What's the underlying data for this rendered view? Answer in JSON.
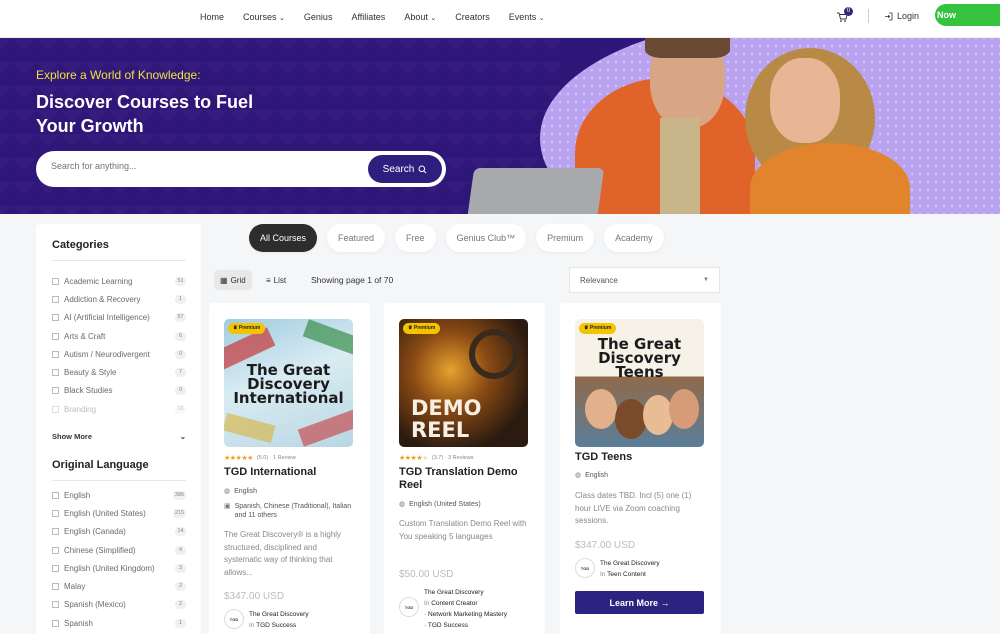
{
  "nav": {
    "links": [
      "Home",
      "Courses",
      "Genius",
      "Affiliates",
      "About",
      "Creators",
      "Events"
    ],
    "cart_count": "0",
    "login": "Login",
    "cta": "Now"
  },
  "hero": {
    "tagline": "Explore a World of Knowledge:",
    "title": "Discover Courses to Fuel Your Growth",
    "search_placeholder": "Search for anything...",
    "search_button": "Search"
  },
  "sidebar": {
    "categories_title": "Categories",
    "categories": [
      {
        "label": "Academic Learning",
        "count": "51"
      },
      {
        "label": "Addiction & Recovery",
        "count": "1"
      },
      {
        "label": "AI (Artificial Intelligence)",
        "count": "57"
      },
      {
        "label": "Arts & Craft",
        "count": "6"
      },
      {
        "label": "Autism / Neurodivergent",
        "count": "0"
      },
      {
        "label": "Beauty & Style",
        "count": "7"
      },
      {
        "label": "Black Studies",
        "count": "0"
      },
      {
        "label": "Branding",
        "count": "16"
      }
    ],
    "show_more": "Show More",
    "language_title": "Original Language",
    "languages": [
      {
        "label": "English",
        "count": "386"
      },
      {
        "label": "English (United States)",
        "count": "215"
      },
      {
        "label": "English (Canada)",
        "count": "14"
      },
      {
        "label": "Chinese (Simplified)",
        "count": "4"
      },
      {
        "label": "English (United Kingdom)",
        "count": "3"
      },
      {
        "label": "Malay",
        "count": "2"
      },
      {
        "label": "Spanish (Mexico)",
        "count": "2"
      },
      {
        "label": "Spanish",
        "count": "1"
      }
    ]
  },
  "tabs": [
    "All Courses",
    "Featured",
    "Free",
    "Genius Club™",
    "Premium",
    "Academy"
  ],
  "toolbar": {
    "grid": "Grid",
    "list": "List",
    "showing": "Showing page 1 of 70",
    "sort": "Relevance"
  },
  "cards": [
    {
      "badge": "Premium",
      "rating": "(5.0) · 1 Review",
      "title": "TGD International",
      "language": "English",
      "subtitles": "Spanish, Chinese (Traditional), Italian and 11 others",
      "description": "The Great Discovery® is a highly structured, disciplined and systematic way of thinking that allows...",
      "price": "$347.00 USD",
      "author": "The Great Discovery",
      "in": "In",
      "category": "TGD Success",
      "logo_text": "The Great Discovery International"
    },
    {
      "badge": "Premium",
      "rating": "(3.7) · 3 Reviews",
      "title": "TGD Translation Demo Reel",
      "language": "English (United States)",
      "description": "Custom Translation Demo Reel with You speaking 5 languages",
      "price": "$50.00 USD",
      "author": "The Great Discovery",
      "in": "In",
      "category": "Content Creator",
      "category2": "· Network Marketing Mastery",
      "category3": "· TGD Success",
      "logo_text": "DEMO REEL"
    },
    {
      "badge": "Premium",
      "title": "TGD Teens",
      "language": "English",
      "description": "Class dates TBD. Incl (5) one (1) hour LIVE via Zoom coaching sessions.",
      "price": "$347.00 USD",
      "author": "The Great Discovery",
      "in": "In",
      "category": "Teen Content",
      "button": "Learn More →",
      "logo_text": "The Great Discovery Teens"
    }
  ],
  "colors": {
    "hero_bg": "#2f1679",
    "accent_yellow": "#f4e23b",
    "primary": "#2e1e7d",
    "cta_green": "#35c23c",
    "star": "#f29b1e"
  }
}
